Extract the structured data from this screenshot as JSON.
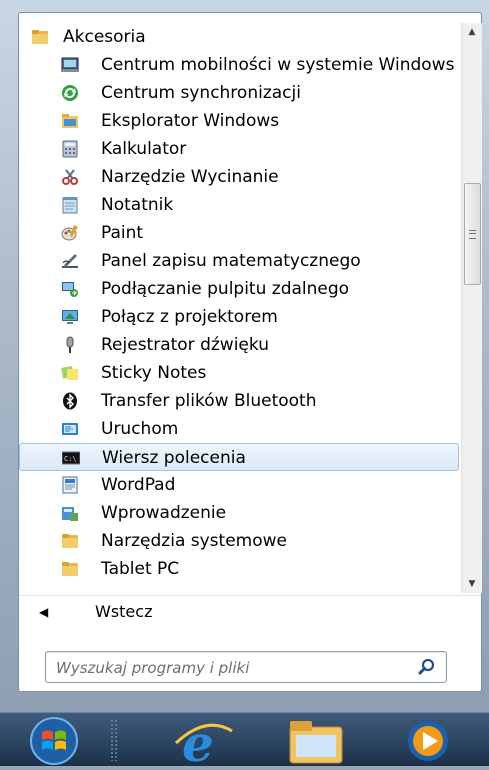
{
  "folder": {
    "label": "Akcesoria",
    "icon": "folder-icon"
  },
  "items": [
    {
      "label": "Centrum mobilności w systemie Windows",
      "icon": "mobility-center-icon"
    },
    {
      "label": "Centrum synchronizacji",
      "icon": "sync-center-icon"
    },
    {
      "label": "Eksplorator Windows",
      "icon": "explorer-icon"
    },
    {
      "label": "Kalkulator",
      "icon": "calculator-icon"
    },
    {
      "label": "Narzędzie Wycinanie",
      "icon": "snipping-tool-icon"
    },
    {
      "label": "Notatnik",
      "icon": "notepad-icon"
    },
    {
      "label": "Paint",
      "icon": "paint-icon"
    },
    {
      "label": "Panel zapisu matematycznego",
      "icon": "math-input-icon"
    },
    {
      "label": "Podłączanie pulpitu zdalnego",
      "icon": "remote-desktop-icon"
    },
    {
      "label": "Połącz z projektorem",
      "icon": "projector-icon"
    },
    {
      "label": "Rejestrator dźwięku",
      "icon": "microphone-icon"
    },
    {
      "label": "Sticky Notes",
      "icon": "sticky-notes-icon"
    },
    {
      "label": "Transfer plików Bluetooth",
      "icon": "bluetooth-icon"
    },
    {
      "label": "Uruchom",
      "icon": "run-icon"
    },
    {
      "label": "Wiersz polecenia",
      "icon": "command-prompt-icon"
    },
    {
      "label": "WordPad",
      "icon": "wordpad-icon"
    },
    {
      "label": "Wprowadzenie",
      "icon": "getting-started-icon"
    },
    {
      "label": "Narzędzia systemowe",
      "icon": "folder-icon"
    },
    {
      "label": "Tablet PC",
      "icon": "folder-icon"
    }
  ],
  "selected_item": "Wiersz polecenia",
  "back": {
    "label": "Wstecz",
    "icon": "left-arrow-icon"
  },
  "search": {
    "placeholder": "Wyszukaj programy i pliki",
    "icon": "magnifier-icon"
  },
  "taskbar": {
    "buttons": [
      {
        "name": "start-orb",
        "icon": "windows-orb-icon"
      },
      {
        "name": "internet-explorer",
        "icon": "ie-icon"
      },
      {
        "name": "windows-explorer",
        "icon": "explorer-folder-icon"
      },
      {
        "name": "media-player",
        "icon": "media-player-icon"
      }
    ]
  },
  "colors": {
    "selection": "#dbe9f8",
    "taskbar": "#2e4763",
    "accent": "#1e6fd0"
  }
}
